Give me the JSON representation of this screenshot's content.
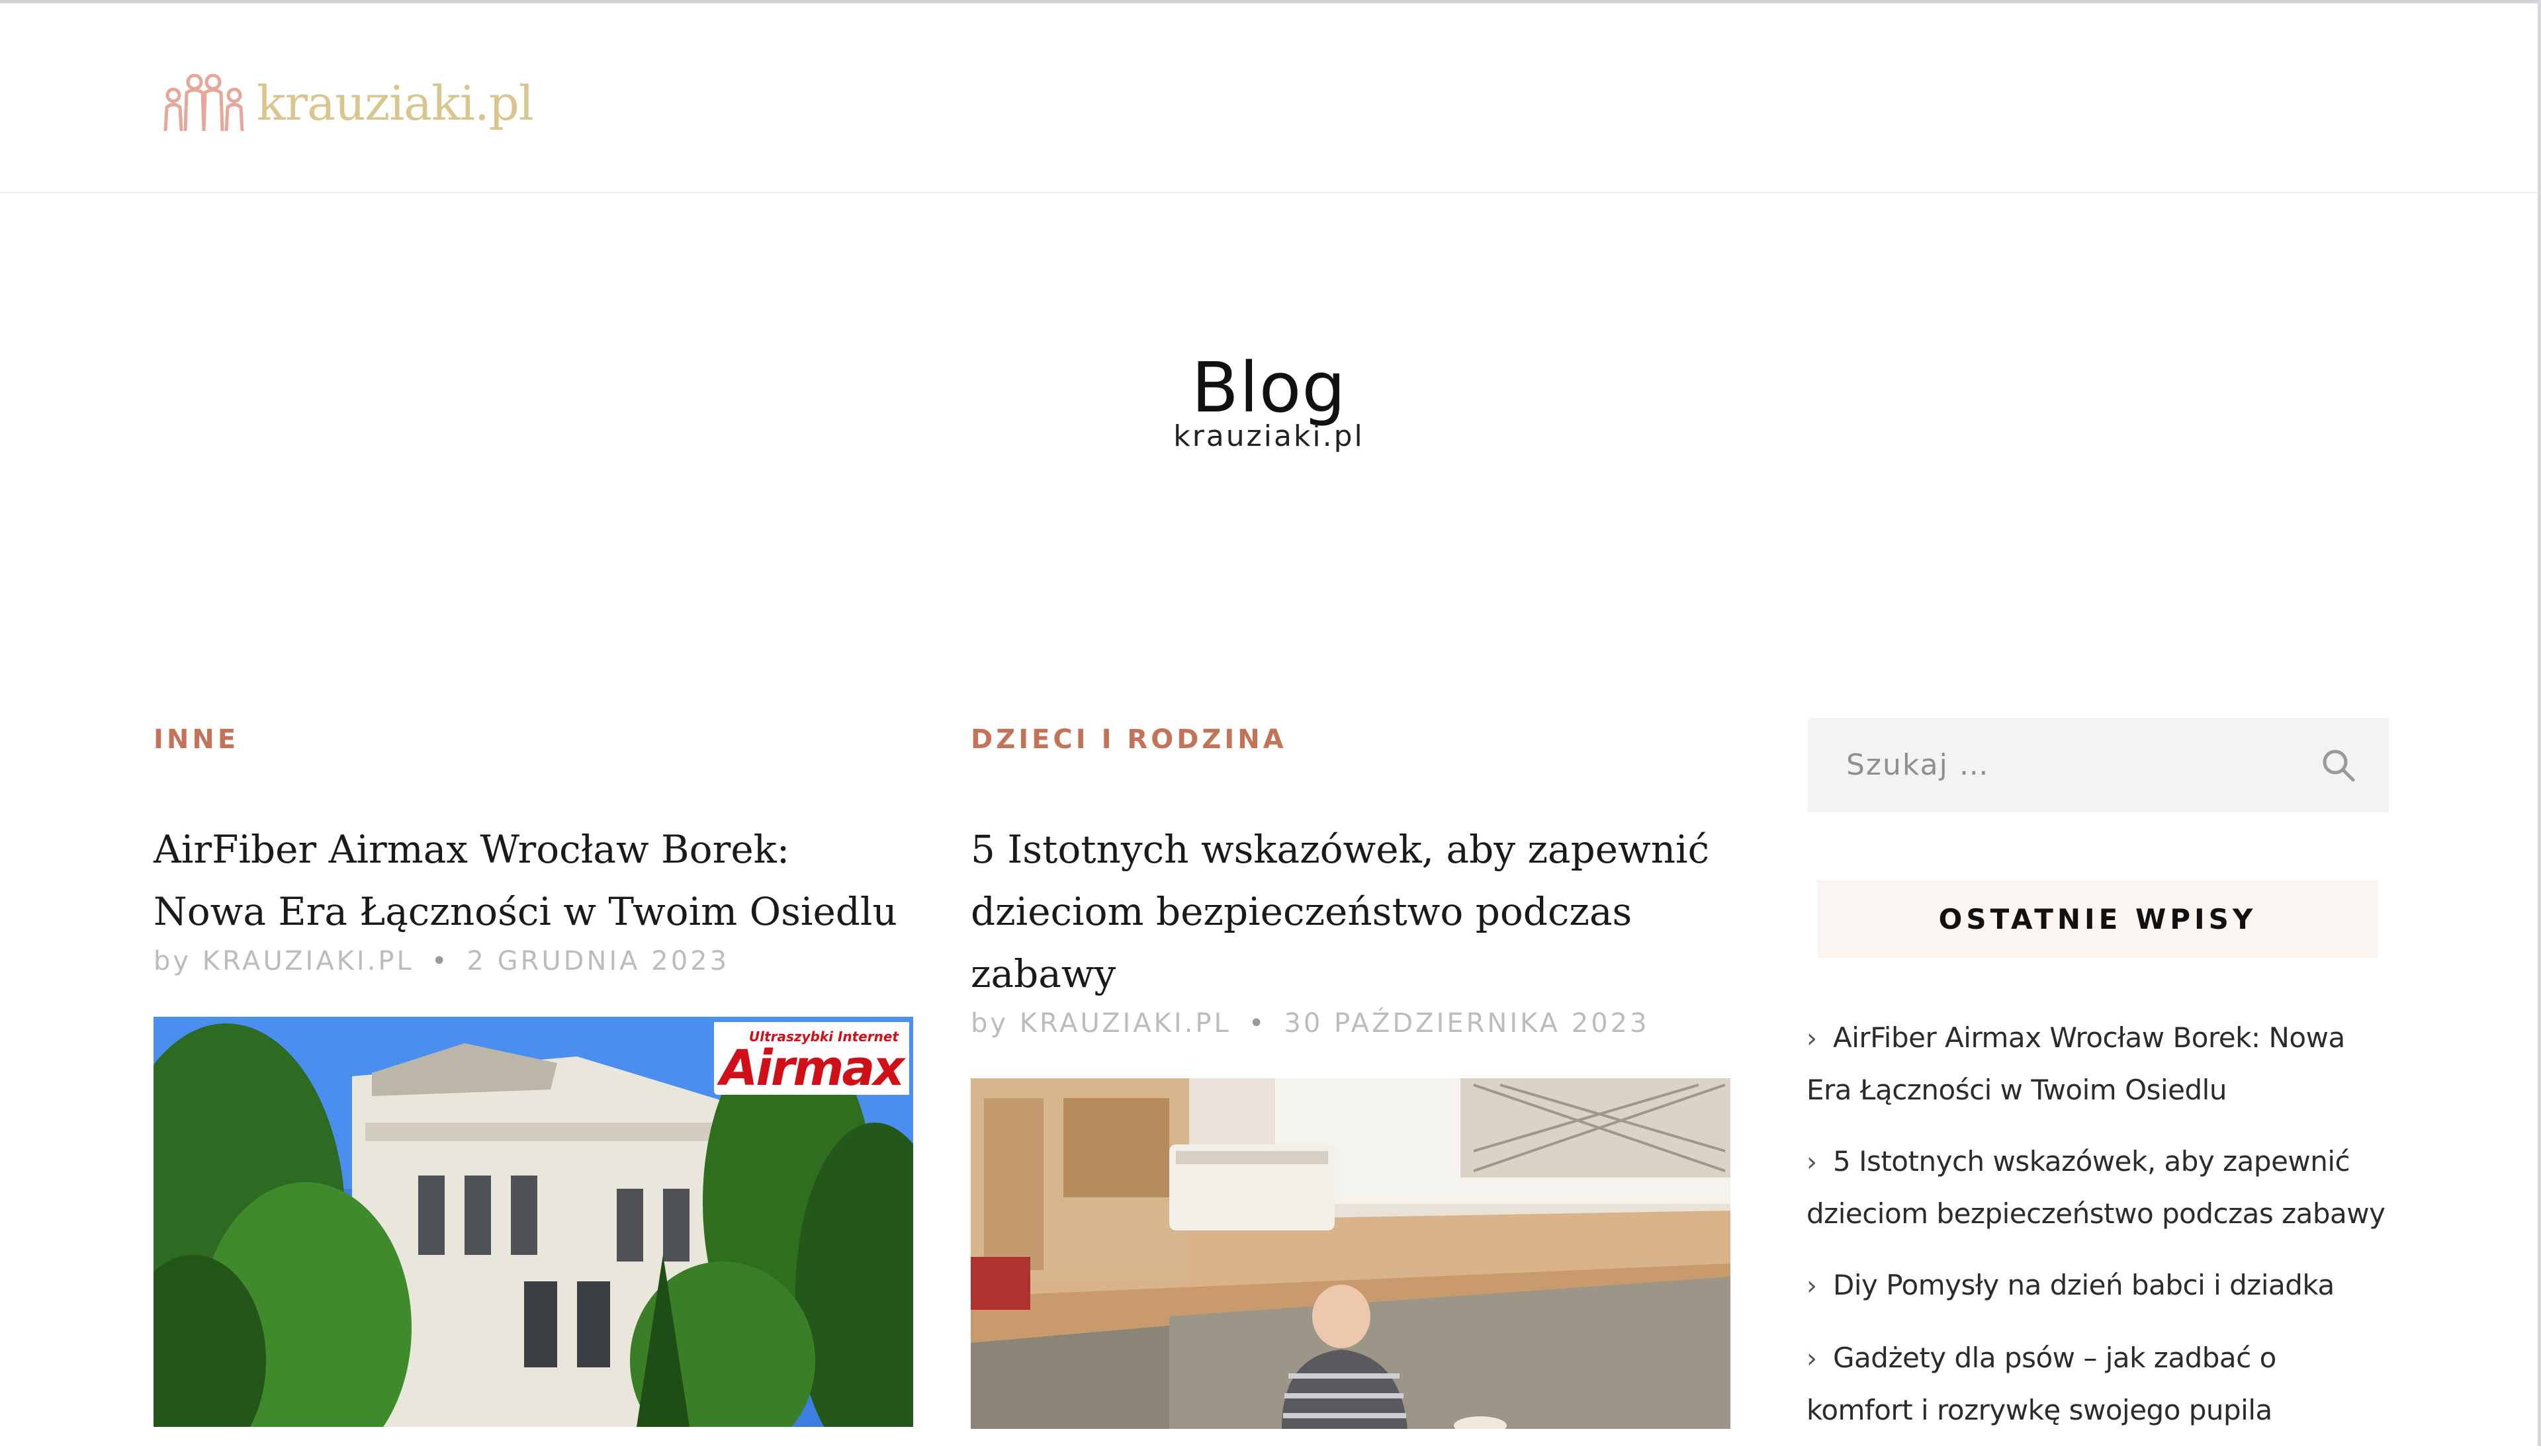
{
  "header": {
    "logo_text": "krauziaki.pl"
  },
  "hero": {
    "title": "Blog",
    "subtitle": "krauziaki.pl"
  },
  "posts": [
    {
      "category": "INNE",
      "title": "AirFiber Airmax Wrocław Borek: Nowa Era Łączności w Twoim Osiedlu",
      "author": "by KRAUZIAKI.PL",
      "date": "2 GRUDNIA 2023",
      "image": {
        "badge_small": "Ultraszybki Internet",
        "badge_main": "Airmax"
      }
    },
    {
      "category": "DZIECI I RODZINA",
      "title": "5 Istotnych wskazówek, aby zapewnić dzieciom bezpieczeństwo podczas zabawy",
      "author": "by KRAUZIAKI.PL",
      "date": "30 PAŹDZIERNIKA 2023"
    }
  ],
  "sidebar": {
    "search": {
      "placeholder": "Szukaj …"
    },
    "recent_heading": "OSTATNIE WPISY",
    "recent_posts": [
      "AirFiber Airmax Wrocław Borek: Nowa Era Łączności w Twoim Osiedlu",
      "5 Istotnych wskazówek, aby zapewnić dzieciom bezpieczeństwo podczas zabawy",
      "Diy Pomysły na dzień babci i dziadka",
      "Gadżety dla psów – jak zadbać o komfort i rozrywkę swojego pupila"
    ]
  },
  "colors": {
    "accent": "#c27358",
    "logo": "#d9c58e",
    "widget_head_bg": "#fbf5f2",
    "search_bg": "#f3f3f3"
  },
  "icons": {
    "logo": "family-icon",
    "search": "search-icon",
    "list_bullet": "chevron-right-icon"
  }
}
